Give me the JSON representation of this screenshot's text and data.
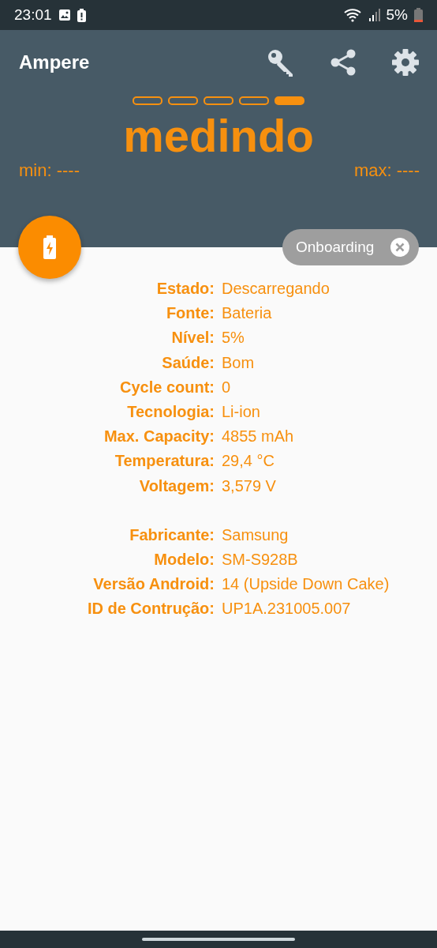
{
  "status_bar": {
    "time": "23:01",
    "battery": "5%"
  },
  "app_bar": {
    "title": "Ampere"
  },
  "pager": [
    {
      "selected": false
    },
    {
      "selected": false
    },
    {
      "selected": false
    },
    {
      "selected": false
    },
    {
      "selected": true
    }
  ],
  "reading": "medindo",
  "min": "min: ----",
  "max": "max: ----",
  "chip": {
    "label": "Onboarding"
  },
  "groups": [
    {
      "rows": [
        {
          "label": "Estado:",
          "value": "Descarregando"
        },
        {
          "label": "Fonte:",
          "value": "Bateria"
        },
        {
          "label": "Nível:",
          "value": "5%"
        },
        {
          "label": "Saúde:",
          "value": "Bom"
        },
        {
          "label": "Cycle count:",
          "value": "0"
        },
        {
          "label": "Tecnologia:",
          "value": "Li-ion"
        },
        {
          "label": "Max. Capacity:",
          "value": "4855 mAh"
        },
        {
          "label": "Temperatura:",
          "value": "29,4 °C"
        },
        {
          "label": "Voltagem:",
          "value": "3,579 V"
        }
      ]
    },
    {
      "rows": [
        {
          "label": "Fabricante:",
          "value": "Samsung"
        },
        {
          "label": "Modelo:",
          "value": "SM-S928B"
        },
        {
          "label": "Versão Android:",
          "value": "14 (Upside Down Cake)"
        },
        {
          "label": "ID de Contrução:",
          "value": "UP1A.231005.007"
        }
      ]
    }
  ]
}
